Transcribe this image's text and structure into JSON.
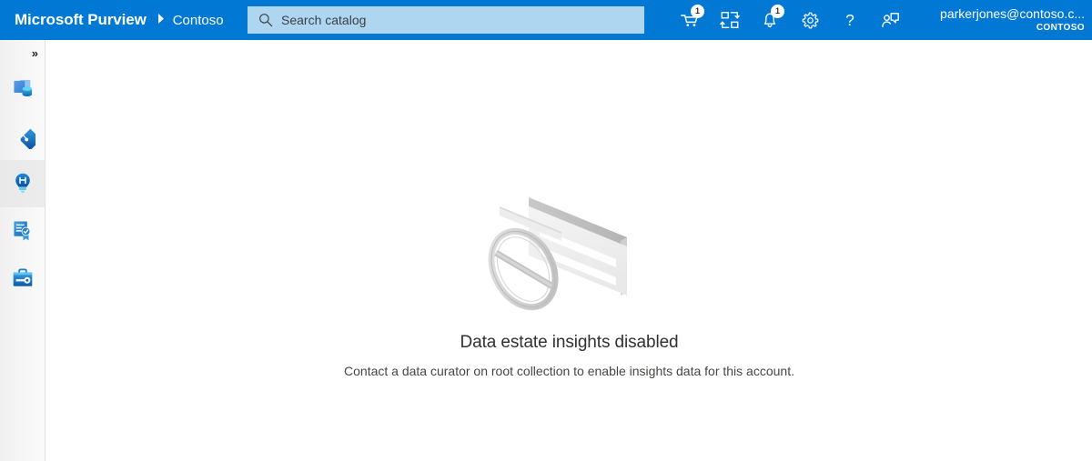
{
  "header": {
    "brand": "Microsoft Purview",
    "separator_icon": "chevron-right-icon",
    "tenant": "Contoso",
    "search": {
      "icon": "search-icon",
      "placeholder": "Search catalog",
      "value": ""
    },
    "icons": [
      {
        "name": "cart-icon",
        "label": "Data cart",
        "badge": "1"
      },
      {
        "name": "data-map-icon",
        "label": "Data map",
        "badge": ""
      },
      {
        "name": "bell-icon",
        "label": "Notifications",
        "badge": "1"
      },
      {
        "name": "gear-icon",
        "label": "Settings",
        "badge": ""
      },
      {
        "name": "question-icon",
        "label": "Help",
        "badge": ""
      },
      {
        "name": "feedback-icon",
        "label": "Feedback",
        "badge": ""
      }
    ],
    "account": {
      "name": "parkerjones@contoso.c...",
      "org": "CONTOSO"
    },
    "colors": {
      "background": "#0078d4",
      "search_background": "#aed6f1",
      "text": "#ffffff"
    }
  },
  "sidebar": {
    "expand_toggle": {
      "name": "expand-nav-button",
      "glyph": "»"
    },
    "items": [
      {
        "name": "sidebar-item-data-catalog",
        "label": "Data catalog",
        "icon": "data-catalog-icon",
        "selected": false
      },
      {
        "name": "sidebar-item-data-map",
        "label": "Data map",
        "icon": "data-map-diamond-icon",
        "selected": false
      },
      {
        "name": "sidebar-item-data-estate-insights",
        "label": "Data estate insights",
        "icon": "lightbulb-icon",
        "selected": true
      },
      {
        "name": "sidebar-item-data-policy",
        "label": "Data policy",
        "icon": "certificate-icon",
        "selected": false
      },
      {
        "name": "sidebar-item-management",
        "label": "Management",
        "icon": "toolbox-icon",
        "selected": false
      }
    ]
  },
  "main": {
    "empty_state": {
      "illustration": "disabled-insights-illustration",
      "title": "Data estate insights disabled",
      "description": "Contact a data curator on root collection to enable insights data for this account."
    }
  }
}
